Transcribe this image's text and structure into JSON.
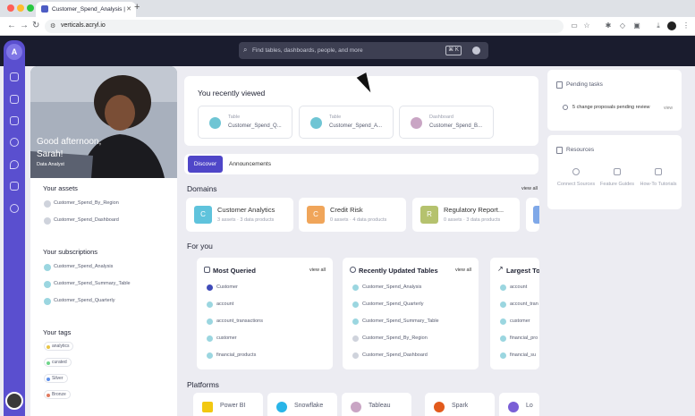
{
  "browser": {
    "tab_title": "Customer_Spend_Analysis |",
    "url": "verticals.acryl.io"
  },
  "search": {
    "placeholder": "Find tables, dashboards, people, and more",
    "shortcut": "⌘ K"
  },
  "profile": {
    "greeting": "Good afternoon, Sarah!",
    "role": "Data Analyst",
    "assets_heading": "Your assets",
    "assets": [
      "Customer_Spend_By_Region",
      "Customer_Spend_Dashboard"
    ],
    "subscriptions_heading": "Your subscriptions",
    "subscriptions": [
      "Customer_Spend_Analysis",
      "Customer_Spend_Summary_Table",
      "Customer_Spend_Quarterly"
    ],
    "tags_heading": "Your tags",
    "tags": [
      {
        "label": "analytics",
        "color": "#e8c547"
      },
      {
        "label": "curated",
        "color": "#6fd48a"
      },
      {
        "label": "Silver",
        "color": "#5f8fe8"
      },
      {
        "label": "Bronze",
        "color": "#e07a5f"
      }
    ]
  },
  "recent": {
    "heading": "You recently viewed",
    "items": [
      {
        "type": "Table",
        "name": "Customer_Spend_Q..."
      },
      {
        "type": "Table",
        "name": "Customer_Spend_A..."
      },
      {
        "type": "Dashboard",
        "name": "Customer_Spend_B..."
      }
    ]
  },
  "tabs": {
    "discover": "Discover",
    "announcements": "Announcements"
  },
  "domains": {
    "heading": "Domains",
    "view_all": "view all",
    "items": [
      {
        "letter": "C",
        "name": "Customer Analytics",
        "meta": "3 assets · 3 data products",
        "color": "#5fc3dc"
      },
      {
        "letter": "C",
        "name": "Credit Risk",
        "meta": "0 assets · 4 data products",
        "color": "#f0a55a"
      },
      {
        "letter": "R",
        "name": "Regulatory Report...",
        "meta": "0 assets · 3 data products",
        "color": "#b5c26e"
      }
    ]
  },
  "for_you": {
    "heading": "For you",
    "most_queried": {
      "title": "Most Queried",
      "view_all": "view all",
      "items": [
        "Customer",
        "account",
        "account_transactions",
        "customer",
        "financial_products"
      ]
    },
    "recently_updated": {
      "title": "Recently Updated Tables",
      "view_all": "view all",
      "items": [
        "Customer_Spend_Analysis",
        "Customer_Spend_Quarterly",
        "Customer_Spend_Summary_Table",
        "Customer_Spend_By_Region",
        "Customer_Spend_Dashboard"
      ]
    },
    "largest": {
      "title": "Largest To",
      "items": [
        "account",
        "account_tran",
        "customer",
        "financial_pro",
        "financial_su"
      ]
    }
  },
  "platforms": {
    "heading": "Platforms",
    "items": [
      {
        "name": "Power BI",
        "color": "#f2c811"
      },
      {
        "name": "Snowflake",
        "color": "#29b5e8"
      },
      {
        "name": "Tableau",
        "color": "#c9a5c4"
      },
      {
        "name": "Spark",
        "color": "#e25a1c"
      },
      {
        "name": "Lo",
        "color": "#7a5fd6"
      }
    ]
  },
  "pending": {
    "title": "Pending tasks",
    "text": "5 change proposals pending review",
    "link": "view"
  },
  "resources": {
    "title": "Resources",
    "items": [
      "Connect Sources",
      "Feature Guides",
      "How-To Tutorials"
    ]
  }
}
